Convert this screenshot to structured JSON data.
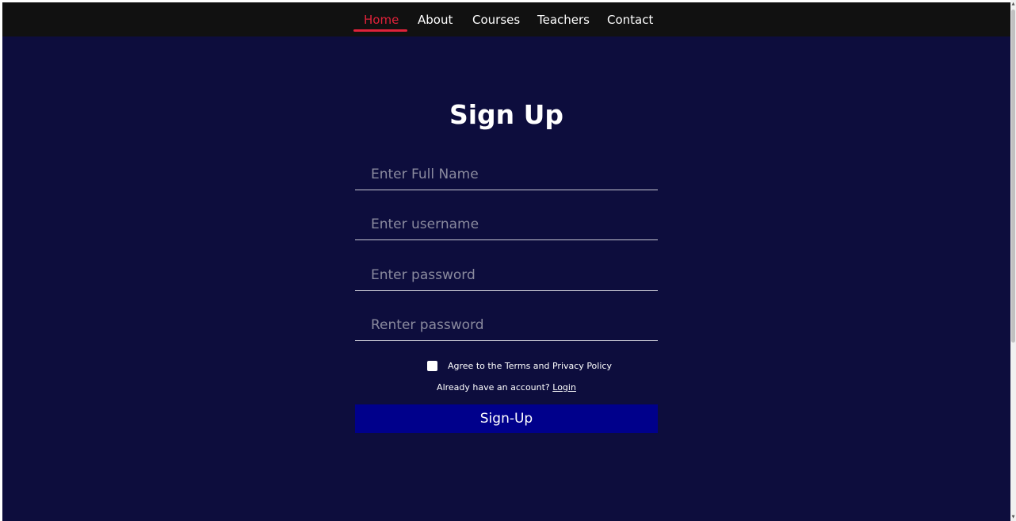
{
  "nav": {
    "items": [
      {
        "label": "Home",
        "active": true
      },
      {
        "label": "About",
        "active": false
      },
      {
        "label": "Courses",
        "active": false
      },
      {
        "label": "Teachers",
        "active": false
      },
      {
        "label": "Contact",
        "active": false
      }
    ],
    "active_color": "#e0223a"
  },
  "form": {
    "title": "Sign Up",
    "fields": [
      {
        "placeholder": "Enter Full Name",
        "value": ""
      },
      {
        "placeholder": "Enter username",
        "value": ""
      },
      {
        "placeholder": "Enter password",
        "value": ""
      },
      {
        "placeholder": "Renter password",
        "value": ""
      }
    ],
    "terms_label": "Agree to the Terms and Privacy Policy",
    "terms_checked": false,
    "login_prompt": "Already have an account?",
    "login_link": "Login",
    "submit_label": "Sign-Up"
  },
  "colors": {
    "page_background": "#0d0d3d",
    "navbar_background": "#111111",
    "button_background": "#00008b"
  }
}
